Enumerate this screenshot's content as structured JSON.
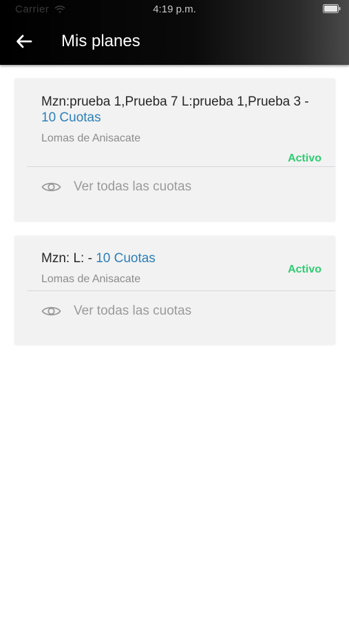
{
  "status_bar": {
    "carrier": "Carrier",
    "time": "4:19 p.m."
  },
  "header": {
    "title": "Mis planes",
    "back_icon": "arrow-left-icon"
  },
  "plans": [
    {
      "description": "Mzn:prueba 1,Prueba 7 L:prueba 1,Prueba 3 -",
      "cuotas": "10 Cuotas",
      "location": "Lomas de Anisacate",
      "status": "Activo",
      "action_label": "Ver todas las cuotas",
      "action_icon": "eye-icon"
    },
    {
      "description": "Mzn: L: -",
      "cuotas": "10 Cuotas",
      "location": "Lomas de Anisacate",
      "status": "Activo",
      "action_label": "Ver todas las cuotas",
      "action_icon": "eye-icon"
    }
  ],
  "colors": {
    "cuotas_link": "#2c7fb8",
    "status_active": "#2ecc71",
    "card_background": "#f2f2f2",
    "header_background": "#000000"
  }
}
